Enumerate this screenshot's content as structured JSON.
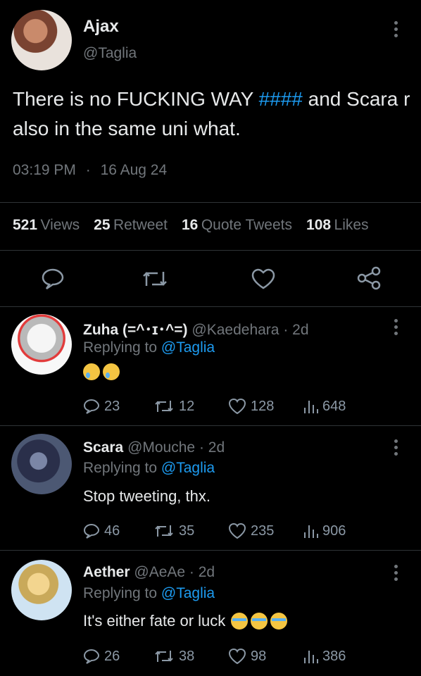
{
  "tweet": {
    "author_name": "Ajax",
    "author_handle": "@Taglia",
    "text_before": "There is no FUCKING WAY",
    "text_hashtag": "####",
    "text_after": "and Scara r also in the same uni what.",
    "time": "03:19 PM",
    "sep": "·",
    "date": "16 Aug 24",
    "stats": {
      "views_count": "521",
      "views_label": "Views",
      "retweets_count": "25",
      "retweets_label": "Retweet",
      "quotes_count": "16",
      "quotes_label": "Quote Tweets",
      "likes_count": "108",
      "likes_label": "Likes"
    }
  },
  "replies": [
    {
      "name": "Zuha (=^･ɪ･^=)",
      "handle": "@Kaedehara",
      "age": "· 2d",
      "replying_prefix": "Replying to",
      "replying_to": "@Taglia",
      "text": "",
      "emojis": [
        "crying-face",
        "crying-face"
      ],
      "comments": "23",
      "retweets": "12",
      "likes": "128",
      "views": "648"
    },
    {
      "name": "Scara",
      "handle": "@Mouche",
      "age": "· 2d",
      "replying_prefix": "Replying to",
      "replying_to": "@Taglia",
      "text": "Stop tweeting, thx.",
      "emojis": [],
      "comments": "46",
      "retweets": "35",
      "likes": "235",
      "views": "906"
    },
    {
      "name": "Aether",
      "handle": "@AeAe",
      "age": "· 2d",
      "replying_prefix": "Replying to",
      "replying_to": "@Taglia",
      "text": "It's either fate or luck",
      "emojis": [
        "loudly-crying-face",
        "loudly-crying-face",
        "loudly-crying-face"
      ],
      "comments": "26",
      "retweets": "38",
      "likes": "98",
      "views": "386"
    }
  ],
  "colors": {
    "background": "#000000",
    "text": "#e7e9ea",
    "muted": "#71767b",
    "link": "#1d9bf0",
    "divider": "#2f3336"
  }
}
